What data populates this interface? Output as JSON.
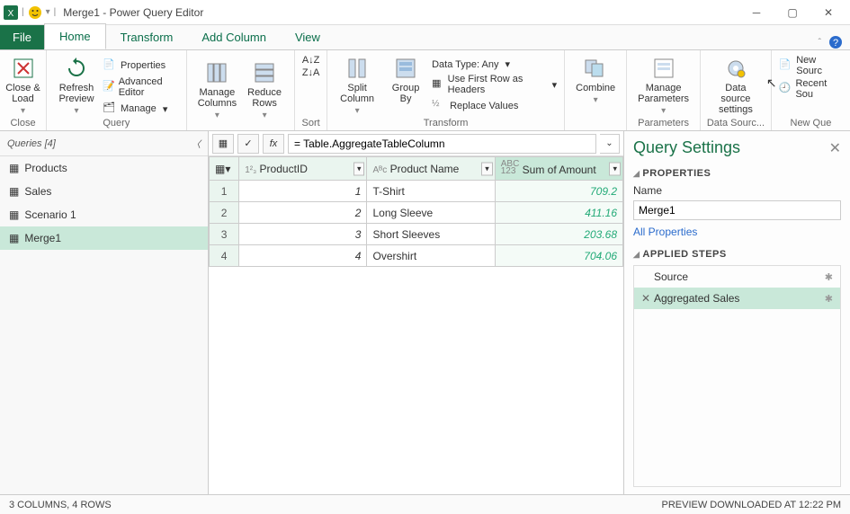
{
  "window": {
    "title": "Merge1 - Power Query Editor",
    "qat_divider": "|",
    "dropdown_glyph": "▾"
  },
  "tabs": {
    "file": "File",
    "home": "Home",
    "transform": "Transform",
    "addcol": "Add Column",
    "view": "View"
  },
  "ribbon": {
    "close": {
      "close_load": "Close &\nLoad",
      "group": "Close"
    },
    "query": {
      "refresh": "Refresh\nPreview",
      "properties": "Properties",
      "advanced": "Advanced Editor",
      "manage": "Manage",
      "group": "Query"
    },
    "cols": {
      "manage_cols": "Manage\nColumns",
      "reduce_rows": "Reduce\nRows"
    },
    "sort": {
      "az": "A↓Z",
      "za": "Z↓A",
      "group": "Sort"
    },
    "transform": {
      "split": "Split\nColumn",
      "groupby": "Group\nBy",
      "datatype": "Data Type: Any",
      "firstrow": "Use First Row as Headers",
      "replace": "Replace Values",
      "group": "Transform"
    },
    "combine": {
      "combine": "Combine",
      "group": ""
    },
    "params": {
      "manage_params": "Manage\nParameters",
      "group": "Parameters"
    },
    "datasrc": {
      "settings": "Data source\nsettings",
      "group": "Data Sourc..."
    },
    "newq": {
      "newsrc": "New Sourc",
      "recent": "Recent Sou",
      "group": "New Que"
    }
  },
  "queries": {
    "header": "Queries [4]",
    "items": [
      {
        "name": "Products"
      },
      {
        "name": "Sales"
      },
      {
        "name": "Scenario 1"
      },
      {
        "name": "Merge1"
      }
    ]
  },
  "formula": "= Table.AggregateTableColumn",
  "grid": {
    "headers": {
      "productid": "ProductID",
      "productname": "Product Name",
      "sum": "Sum of Amount"
    },
    "type_prefix": {
      "num": "1²₃",
      "text": "Aᴮc",
      "abc123": "ABC\n123"
    },
    "rows": [
      {
        "id": "1",
        "name": "T-Shirt",
        "sum": "709.2"
      },
      {
        "id": "2",
        "name": "Long Sleeve",
        "sum": "411.16"
      },
      {
        "id": "3",
        "name": "Short Sleeves",
        "sum": "203.68"
      },
      {
        "id": "4",
        "name": "Overshirt",
        "sum": "704.06"
      }
    ]
  },
  "settings": {
    "title": "Query Settings",
    "props": "PROPERTIES",
    "name_label": "Name",
    "name_value": "Merge1",
    "all_props": "All Properties",
    "steps_label": "APPLIED STEPS",
    "steps": [
      {
        "name": "Source",
        "gear": "✱"
      },
      {
        "name": "Aggregated Sales",
        "gear": "✱",
        "xmark": "✕"
      }
    ]
  },
  "statusbar": {
    "left": "3 COLUMNS, 4 ROWS",
    "right": "PREVIEW DOWNLOADED AT 12:22 PM"
  }
}
